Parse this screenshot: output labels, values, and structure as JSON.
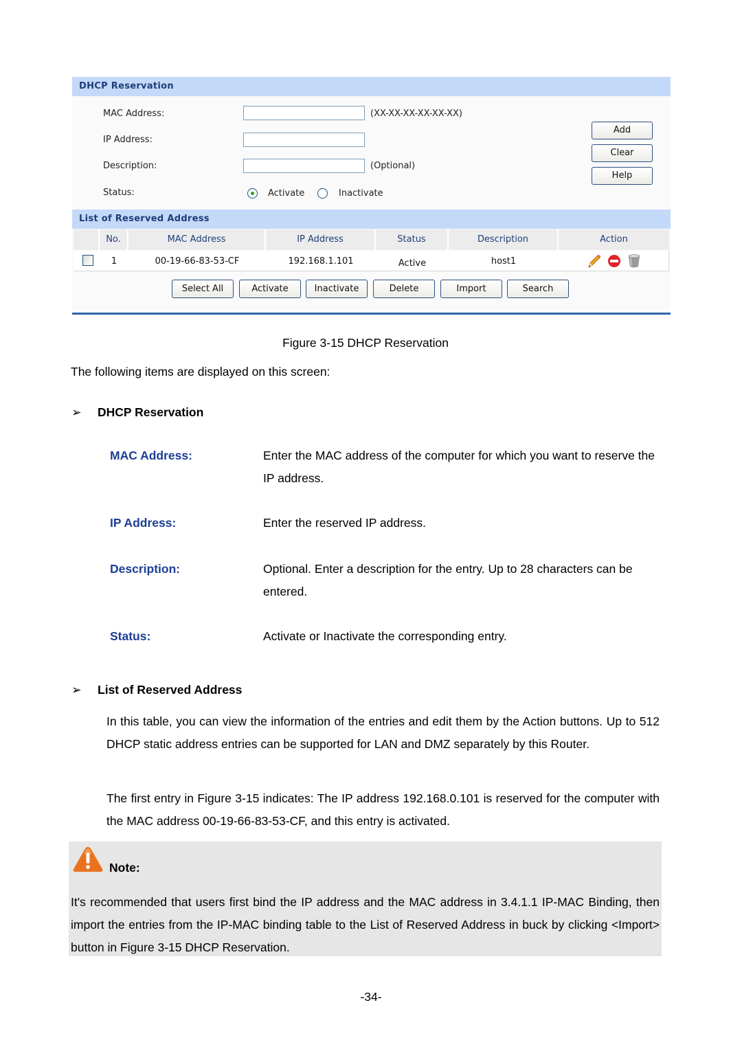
{
  "screenshot": {
    "reservation_section": {
      "title": "DHCP Reservation",
      "fields": {
        "mac": {
          "label": "MAC Address:",
          "value": "",
          "hint": "(XX-XX-XX-XX-XX-XX)"
        },
        "ip": {
          "label": "IP Address:",
          "value": ""
        },
        "description": {
          "label": "Description:",
          "value": "",
          "hint": "(Optional)"
        },
        "status": {
          "label": "Status:",
          "options": [
            "Activate",
            "Inactivate"
          ],
          "selected": "Activate"
        }
      },
      "buttons": {
        "add": "Add",
        "clear": "Clear",
        "help": "Help"
      }
    },
    "list_section": {
      "title": "List of Reserved Address",
      "columns": [
        "No.",
        "MAC Address",
        "IP Address",
        "Status",
        "Description",
        "Action"
      ],
      "rows": [
        {
          "checked": false,
          "no": "1",
          "mac": "00-19-66-83-53-CF",
          "ip": "192.168.1.101",
          "status": "Active",
          "description": "host1",
          "actions": [
            "edit-icon",
            "disable-icon",
            "delete-icon"
          ]
        }
      ],
      "buttons": {
        "select_all": "Select All",
        "activate": "Activate",
        "inactivate": "Inactivate",
        "delete": "Delete",
        "import": "Import",
        "search": "Search"
      }
    }
  },
  "document": {
    "figure_caption": "Figure 3-15 DHCP Reservation",
    "intro": "The following items are displayed on this screen:",
    "section1": {
      "bullet": "➢",
      "title": "DHCP Reservation",
      "items": [
        {
          "term": "MAC Address:",
          "definition": "Enter the MAC address of the computer for which you want to reserve the IP address."
        },
        {
          "term": "IP Address:",
          "definition": "Enter the reserved IP address."
        },
        {
          "term": "Description:",
          "definition": "Optional. Enter a description for the entry. Up to 28 characters can be entered."
        },
        {
          "term": "Status:",
          "definition": "Activate or Inactivate the corresponding entry."
        }
      ]
    },
    "section2": {
      "bullet": "➢",
      "title": "List of Reserved Address",
      "paragraphs": [
        "In this table, you can view the information of the entries and edit them by the Action buttons. Up to 512 DHCP static address entries can be supported for LAN and DMZ separately by this Router.",
        "The first entry in Figure 3-15 indicates: The IP address 192.168.0.101 is reserved for the computer with the MAC address 00-19-66-83-53-CF, and this entry is activated."
      ]
    },
    "note": {
      "icon": "warning-icon",
      "title": "Note:",
      "text": "It's recommended that users first bind the IP address and the MAC address in 3.4.1.1 IP-MAC Binding, then import the entries from the IP-MAC binding table to the List of Reserved Address in buck by clicking <Import> button in Figure 3-15 DHCP Reservation."
    },
    "page_number": "-34-"
  },
  "colors": {
    "section_header_bg": "#c4d8f8",
    "section_header_text": "#1d3e78",
    "term_blue": "#1c3f95",
    "note_bg": "#e6e6e6",
    "warning_orange": "#e8731f",
    "rule_blue": "#2f66a8"
  }
}
